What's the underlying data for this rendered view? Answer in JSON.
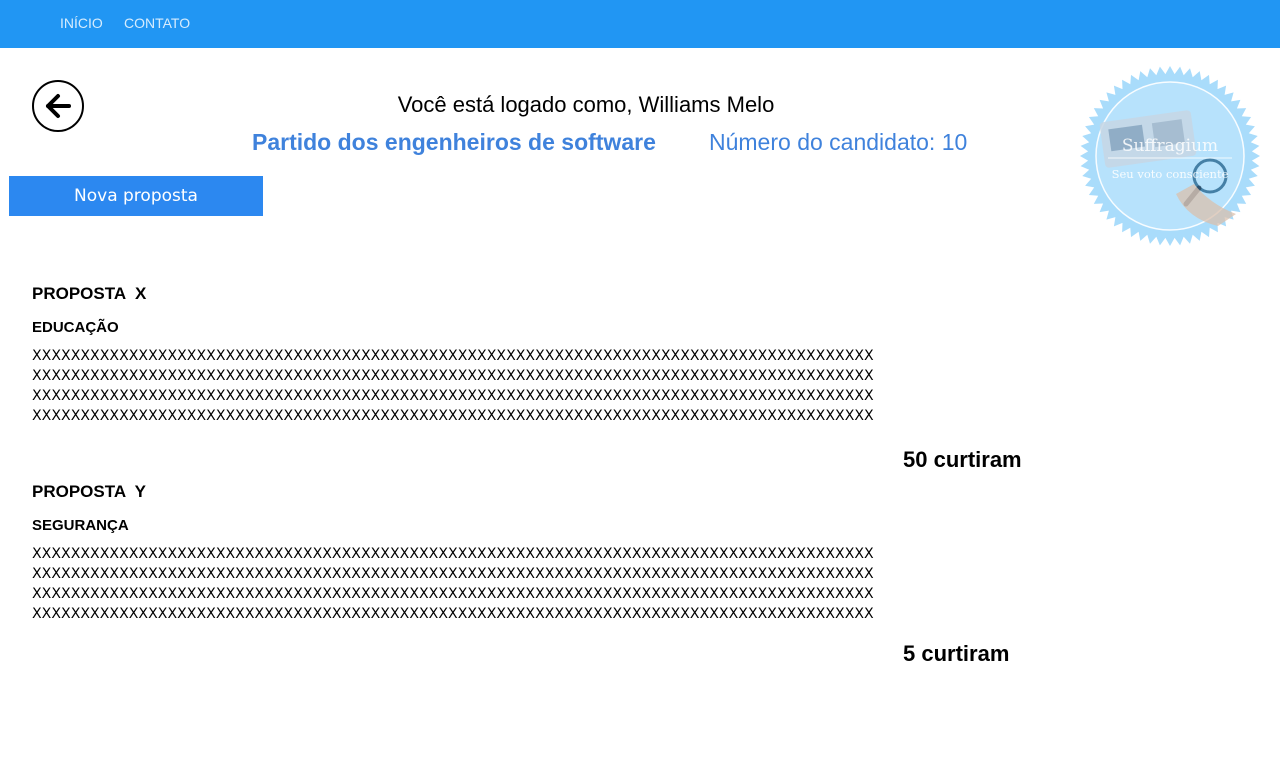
{
  "nav": {
    "home_label": "INÍCIO",
    "contact_label": "CONTATO"
  },
  "header": {
    "logged_as": "Você está logado como, Williams Melo",
    "party": "Partido dos engenheiros de software",
    "candidate_number": "Número do candidato: 10",
    "new_proposal_label": "Nova proposta"
  },
  "logo": {
    "title": "Suffragium",
    "tagline": "Seu voto consciente"
  },
  "proposals": [
    {
      "title": "PROPOSTA  X",
      "category": "EDUCAÇÃO",
      "lines": [
        "XXXXXXXXXXXXXXXXXXXXXXXXXXXXXXXXXXXXXXXXXXXXXXXXXXXXXXXXXXXXXXXXXXXXXXXXXXXXXXXXXXXXXXX",
        "XXXXXXXXXXXXXXXXXXXXXXXXXXXXXXXXXXXXXXXXXXXXXXXXXXXXXXXXXXXXXXXXXXXXXXXXXXXXXXXXXXXXXXX",
        "XXXXXXXXXXXXXXXXXXXXXXXXXXXXXXXXXXXXXXXXXXXXXXXXXXXXXXXXXXXXXXXXXXXXXXXXXXXXXXXXXXXXXXX",
        "XXXXXXXXXXXXXXXXXXXXXXXXXXXXXXXXXXXXXXXXXXXXXXXXXXXXXXXXXXXXXXXXXXXXXXXXXXXXXXXXXXXXXXX"
      ],
      "likes": "50 curtiram"
    },
    {
      "title": "PROPOSTA  Y",
      "category": "SEGURANÇA",
      "lines": [
        "XXXXXXXXXXXXXXXXXXXXXXXXXXXXXXXXXXXXXXXXXXXXXXXXXXXXXXXXXXXXXXXXXXXXXXXXXXXXXXXXXXXXXXX",
        "XXXXXXXXXXXXXXXXXXXXXXXXXXXXXXXXXXXXXXXXXXXXXXXXXXXXXXXXXXXXXXXXXXXXXXXXXXXXXXXXXXXXXXX",
        "XXXXXXXXXXXXXXXXXXXXXXXXXXXXXXXXXXXXXXXXXXXXXXXXXXXXXXXXXXXXXXXXXXXXXXXXXXXXXXXXXXXXXXX",
        "XXXXXXXXXXXXXXXXXXXXXXXXXXXXXXXXXXXXXXXXXXXXXXXXXXXXXXXXXXXXXXXXXXXXXXXXXXXXXXXXXXXXXXX"
      ],
      "likes": "5 curtiram"
    }
  ],
  "colors": {
    "navbar": "#2196f3",
    "accent_text": "#3f82dc",
    "button": "#2c88f0",
    "seal": "#a9dcfb"
  },
  "icons": {
    "back": "arrow-left-icon",
    "logo": "seal-icon"
  }
}
